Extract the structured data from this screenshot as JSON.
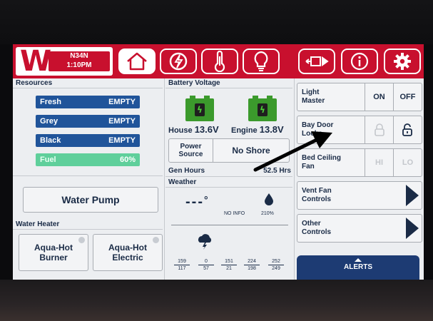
{
  "header": {
    "logo": "W",
    "unit_id": "N34N",
    "time": "1:10PM",
    "nav": [
      "home-icon",
      "generator-icon",
      "thermometer-icon",
      "lightbulb-icon",
      "slide-out-icon",
      "info-icon",
      "gear-icon"
    ]
  },
  "resources": {
    "title": "Resources",
    "tanks": [
      {
        "name": "Fresh",
        "value": "EMPTY"
      },
      {
        "name": "Grey",
        "value": "EMPTY"
      },
      {
        "name": "Black",
        "value": "EMPTY"
      },
      {
        "name": "Fuel",
        "value": "60%",
        "fill_fraction": 0.6
      }
    ]
  },
  "water_pump": {
    "label": "Water Pump"
  },
  "water_heater": {
    "title": "Water Heater",
    "burner": "Aqua-Hot Burner",
    "burner_l1": "Aqua-Hot",
    "burner_l2": "Burner",
    "electric_l1": "Aqua-Hot",
    "electric_l2": "Electric"
  },
  "battery": {
    "title": "Battery Voltage",
    "house_label": "House",
    "house_value": "13.6V",
    "engine_label": "Engine",
    "engine_value": "13.8V"
  },
  "power": {
    "label_l1": "Power",
    "label_l2": "Source",
    "value": "No Shore"
  },
  "gen": {
    "label": "Gen Hours",
    "value": "52.5 Hrs"
  },
  "weather": {
    "title": "Weather",
    "temp": "---",
    "unit": "°",
    "no_info": "NO INFO",
    "humidity": "210%",
    "forecast": [
      {
        "hi": "159",
        "lo": "117"
      },
      {
        "hi": "0",
        "lo": "57"
      },
      {
        "hi": "151",
        "lo": "21"
      },
      {
        "hi": "224",
        "lo": "198"
      },
      {
        "hi": "252",
        "lo": "249"
      }
    ]
  },
  "controls": {
    "light_l1": "Light",
    "light_l2": "Master",
    "on": "ON",
    "off": "OFF",
    "bay_l1": "Bay Door",
    "bay_l2": "Locks",
    "fan_l1": "Bed Ceiling",
    "fan_l2": "Fan",
    "hi": "HI",
    "lo": "LO",
    "vent_l1": "Vent Fan",
    "vent_l2": "Controls",
    "other_l1": "Other",
    "other_l2": "Controls"
  },
  "alerts": {
    "label": "ALERTS"
  },
  "colors": {
    "brand_red": "#c8102e",
    "tank_blue": "#20549a",
    "fuel_green": "#5fcf9b",
    "navy": "#1a2b46"
  }
}
